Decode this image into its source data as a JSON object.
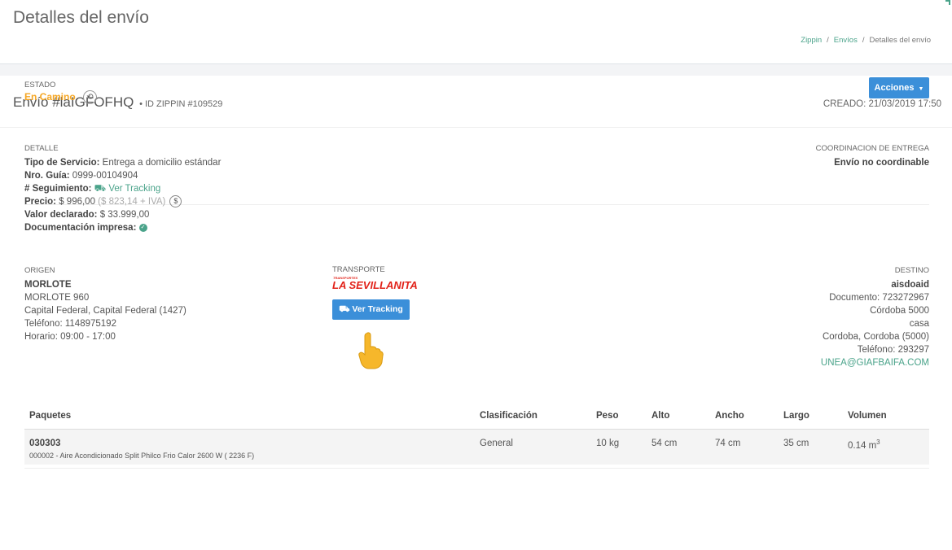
{
  "header": {
    "title": "Detalles del envío",
    "breadcrumb": [
      "Zippin",
      "Envíos",
      "Detalles del envío"
    ]
  },
  "order": {
    "title": "Envío #laIGFOFHQ",
    "sub": "• ID ZIPPIN #109529",
    "created": "CREADO: 21/03/2019 17:50"
  },
  "estado": {
    "label": "ESTADO",
    "value": "En Camino",
    "history_icon": "history-icon",
    "color": "#f5a623"
  },
  "actions_button": "Acciones",
  "detalle": {
    "label": "DETALLE",
    "servicio_label": "Tipo de Servicio:",
    "servicio_value": "Entrega a domicilio estándar",
    "guia_label": "Nro. Guía:",
    "guia_value": "0999-00104904",
    "seguimiento_label": "# Seguimiento:",
    "seguimiento_value": "Ver Tracking",
    "precio_label": "Precio:",
    "precio_value": "$ 996,00",
    "precio_iva": "($ 823,14 + IVA)",
    "valor_label": "Valor declarado:",
    "valor_value": "$ 33.999,00",
    "doc_label": "Documentación impresa:"
  },
  "coordinacion": {
    "label": "COORDINACION DE ENTREGA",
    "value": "Envío no coordinable"
  },
  "origen": {
    "label": "ORIGEN",
    "name": "MORLOTE",
    "address": "MORLOTE 960",
    "city": "Capital Federal, Capital Federal (1427)",
    "phone": "Teléfono: 1148975192",
    "hours": "Horario: 09:00 - 17:00"
  },
  "transporte": {
    "label": "TRANSPORTE",
    "carrier": "LA SEVILLANITA",
    "carrier_small": "TRANSPORTES",
    "tracking_button": "Ver Tracking"
  },
  "destino": {
    "label": "DESTINO",
    "name": "aisdoaid",
    "documento": "Documento: 723272967",
    "address": "Córdoba 5000",
    "extra": "casa",
    "city": "Cordoba, Cordoba (5000)",
    "phone": "Teléfono: 293297",
    "email": "UNEA@GIAFBAIFA.COM"
  },
  "table": {
    "headers": [
      "Paquetes",
      "Clasificación",
      "Peso",
      "Alto",
      "Ancho",
      "Largo",
      "Volumen"
    ],
    "row": {
      "code": "030303",
      "desc": "000002 - Aire Acondicionado Split Philco Frio Calor 2600 W ( 2236 F)",
      "clasificacion": "General",
      "peso": "10 kg",
      "alto": "54 cm",
      "ancho": "74 cm",
      "largo": "35 cm",
      "volumen": "0.14 m",
      "volumen_exp": "3"
    }
  },
  "colors": {
    "accent": "#3b8fd9",
    "link": "#4aa38a",
    "carrier_red": "#e2231a"
  }
}
